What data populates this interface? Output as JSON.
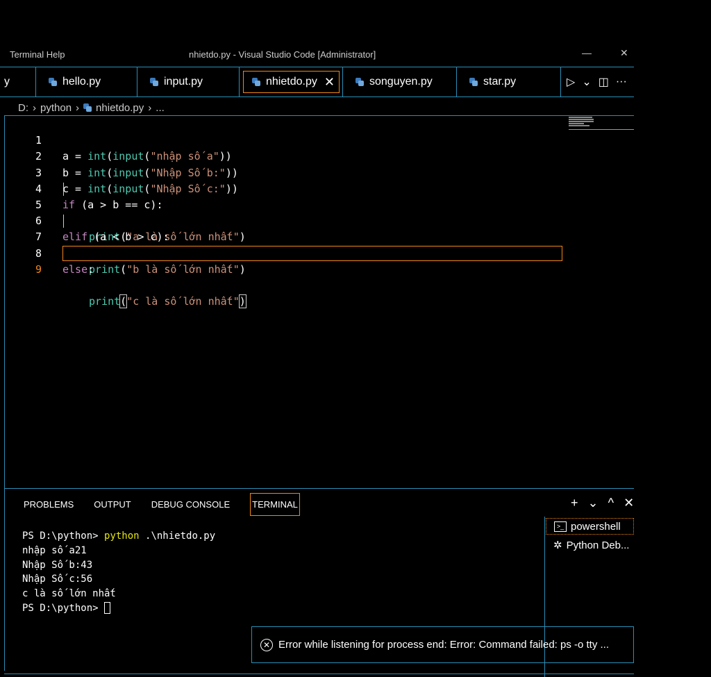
{
  "titlebar": {
    "menu": "Terminal   Help",
    "title": "nhietdo.py - Visual Studio Code [Administrator]",
    "minimize": "—",
    "close": "✕"
  },
  "tabs": [
    {
      "label": "y"
    },
    {
      "label": "hello.py"
    },
    {
      "label": "input.py"
    },
    {
      "label": "nhietdo.py",
      "close": "✕"
    },
    {
      "label": "songuyen.py"
    },
    {
      "label": "star.py"
    }
  ],
  "tab_actions": {
    "run": "▷",
    "dropdown": "⌄",
    "split": "◫",
    "more": "···"
  },
  "breadcrumb": {
    "drive": "D:",
    "sep": "›",
    "folder": "python",
    "file": "nhietdo.py",
    "rest": "..."
  },
  "code": {
    "line_numbers": [
      "1",
      "2",
      "3",
      "4",
      "5",
      "6",
      "7",
      "8",
      "9"
    ],
    "l1": {
      "a": "a = ",
      "fn": "int",
      "p1": "(",
      "fn2": "input",
      "p2": "(",
      "s": "\"nhập số a\"",
      "e": "))"
    },
    "l2": {
      "a": "b = ",
      "fn": "int",
      "p1": "(",
      "fn2": "input",
      "p2": "(",
      "s": "\"Nhập Số b:\"",
      "e": "))"
    },
    "l3": {
      "a": "c = ",
      "fn": "int",
      "p1": "(",
      "fn2": "input",
      "p2": "(",
      "s": "\"Nhập Số c:\"",
      "e": "))"
    },
    "l4": {
      "kw": "if",
      "rest": " (a > b == c):"
    },
    "l5": {
      "fn": "print",
      "p": "(",
      "s": "\"a là số lớn nhất\"",
      "e": ")"
    },
    "l6": {
      "kw": "elif",
      "rest": " (a < b > c):"
    },
    "l7": {
      "fn": "print",
      "p": "(",
      "s": "\"b là số lớn nhất\"",
      "e": ")"
    },
    "l8": {
      "kw": "else",
      "rest": ":"
    },
    "l9": {
      "fn": "print",
      "p": "(",
      "s": "\"c là số lớn nhất\"",
      "e": ")"
    }
  },
  "panel": {
    "tabs": [
      "PROBLEMS",
      "OUTPUT",
      "DEBUG CONSOLE",
      "TERMINAL"
    ],
    "actions": {
      "add": "+",
      "dropdown": "⌄",
      "maximize": "^",
      "close": "✕"
    }
  },
  "terminal": {
    "prompt1": "PS D:\\python> ",
    "cmd": "python",
    "arg": " .\\nhietdo.py",
    "out1": "nhập số a21",
    "out2": "Nhập Số b:43",
    "out3": "Nhập Số c:56",
    "out4": "c là số lớn nhất",
    "prompt2": "PS D:\\python> "
  },
  "terminal_list": [
    {
      "icon": "terminal-icon",
      "label": "powershell"
    },
    {
      "icon": "debug-icon",
      "label": "Python Deb..."
    }
  ],
  "notification": {
    "text": "Error while listening for process end: Error: Command failed: ps -o tty ..."
  },
  "colors": {
    "accent": "#2a8fb8",
    "focus": "#f38518",
    "keyword": "#c586c0",
    "function": "#4ec9b0",
    "string": "#ce9178"
  }
}
